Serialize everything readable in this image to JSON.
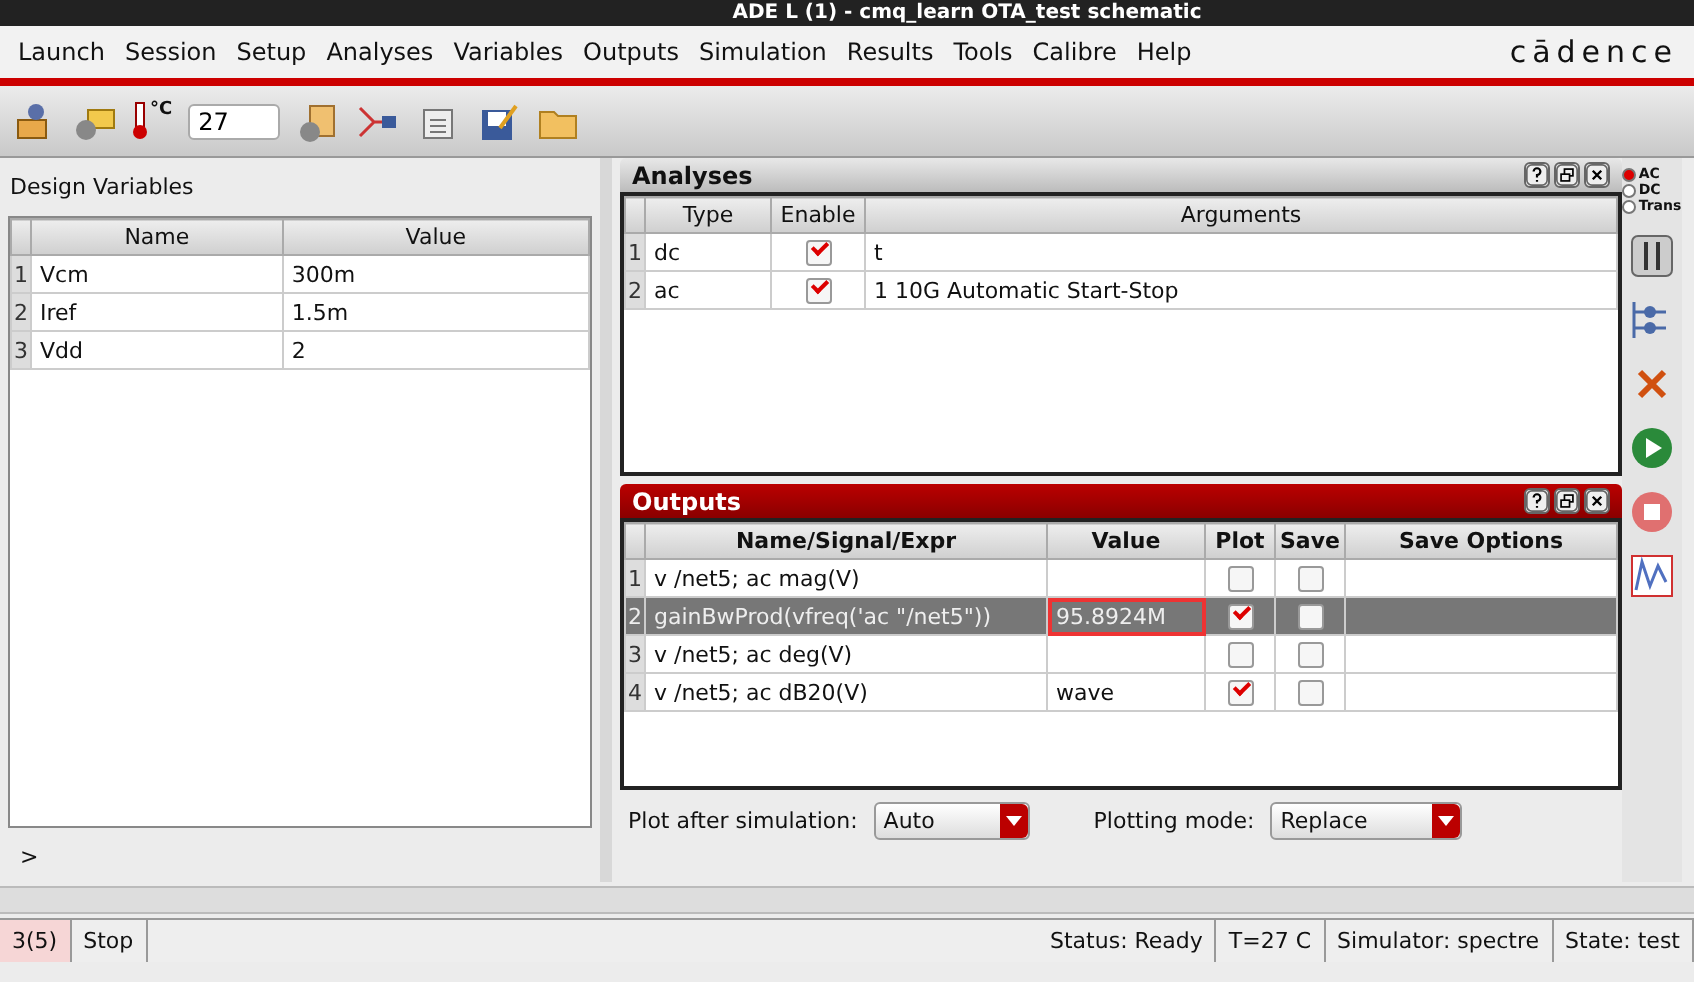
{
  "window": {
    "title": "ADE L (1) - cmq_learn OTA_test schematic"
  },
  "menu": [
    "Launch",
    "Session",
    "Setup",
    "Analyses",
    "Variables",
    "Outputs",
    "Simulation",
    "Results",
    "Tools",
    "Calibre",
    "Help"
  ],
  "brand": "cādence",
  "toolbar": {
    "temperature_unit": "°C",
    "temperature": "27"
  },
  "design_variables": {
    "title": "Design Variables",
    "columns": [
      "Name",
      "Value"
    ],
    "rows": [
      {
        "index": "1",
        "name": "Vcm",
        "value": "300m"
      },
      {
        "index": "2",
        "name": "Iref",
        "value": "1.5m"
      },
      {
        "index": "3",
        "name": "Vdd",
        "value": "2"
      }
    ],
    "prompt": ">"
  },
  "analyses": {
    "title": "Analyses",
    "columns": [
      "Type",
      "Enable",
      "Arguments"
    ],
    "rows": [
      {
        "index": "1",
        "type": "dc",
        "enabled": true,
        "arguments": "t"
      },
      {
        "index": "2",
        "type": "ac",
        "enabled": true,
        "arguments": "1 10G Automatic Start-Stop"
      }
    ]
  },
  "outputs": {
    "title": "Outputs",
    "columns": [
      "Name/Signal/Expr",
      "Value",
      "Plot",
      "Save",
      "Save Options"
    ],
    "rows": [
      {
        "index": "1",
        "name": "v /net5; ac mag(V)",
        "value": "",
        "plot": false,
        "save": false,
        "selected": false,
        "marked": false
      },
      {
        "index": "2",
        "name": "gainBwProd(vfreq('ac \"/net5\"))",
        "value": "95.8924M",
        "plot": true,
        "save": false,
        "selected": true,
        "marked": true
      },
      {
        "index": "3",
        "name": "v /net5; ac deg(V)",
        "value": "",
        "plot": false,
        "save": false,
        "selected": false,
        "marked": false
      },
      {
        "index": "4",
        "name": "v /net5; ac dB20(V)",
        "value": "wave",
        "plot": true,
        "save": false,
        "selected": false,
        "marked": false
      }
    ],
    "plot_after_label": "Plot after simulation:",
    "plot_after": "Auto",
    "plotting_mode_label": "Plotting mode:",
    "plotting_mode": "Replace"
  },
  "analysis_modes": [
    {
      "label": "AC",
      "selected": true
    },
    {
      "label": "DC",
      "selected": false
    },
    {
      "label": "Trans",
      "selected": false
    }
  ],
  "status_bar": {
    "count": "3(5)",
    "action": "Stop",
    "status": "Status: Ready",
    "temperature": "T=27  C",
    "simulator": "Simulator: spectre",
    "state": "State: test"
  }
}
